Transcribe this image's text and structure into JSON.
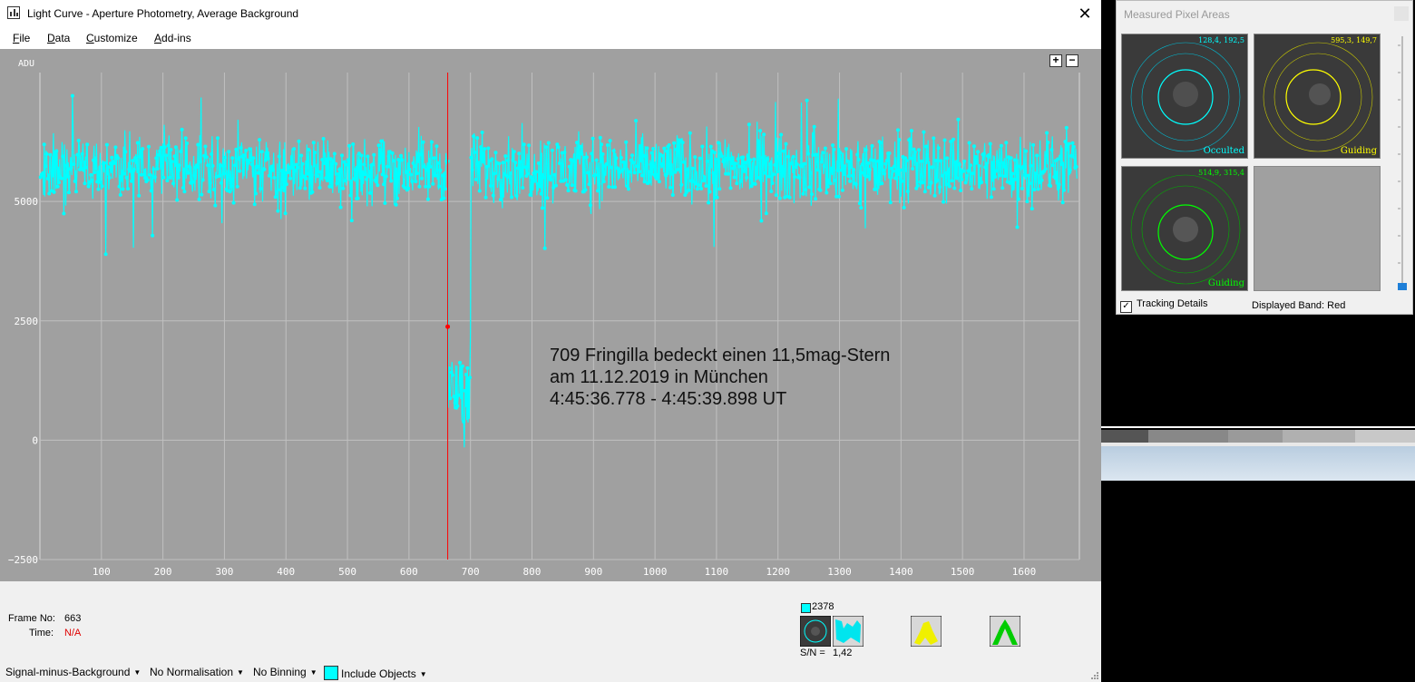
{
  "window": {
    "title": "Light Curve - Aperture Photometry, Average Background",
    "close_glyph": "✕"
  },
  "menu": [
    {
      "label": "File",
      "accel": "F",
      "rest": "ile"
    },
    {
      "label": "Data",
      "accel": "D",
      "rest": "ata"
    },
    {
      "label": "Customize",
      "accel": "C",
      "rest": "ustomize"
    },
    {
      "label": "Add-ins",
      "accel": "A",
      "rest": "dd-ins"
    }
  ],
  "plot": {
    "zoom_in": "+",
    "zoom_out": "−",
    "annotation": [
      "709 Fringilla bedeckt einen 11,5mag-Stern",
      "am 11.12.2019 in München",
      "4:45:36.778 - 4:45:39.898 UT"
    ]
  },
  "chart_data": {
    "type": "line",
    "title": "",
    "ylabel": "ADU",
    "xlabel": "",
    "xlim": [
      0,
      1690
    ],
    "ylim": [
      -2500,
      7700
    ],
    "x_ticks": [
      100,
      200,
      300,
      400,
      500,
      600,
      700,
      800,
      900,
      1000,
      1100,
      1200,
      1300,
      1400,
      1500,
      1600
    ],
    "y_ticks": [
      -2500,
      0,
      2500,
      5000
    ],
    "y_tick_labels": [
      "−2500",
      "0",
      "2500",
      "5000"
    ],
    "grid": true,
    "series": [
      {
        "color": "#00ffff",
        "baseline": 5700,
        "noise_amplitude": 500,
        "frames": 1686,
        "occultation": {
          "start_frame": 664,
          "end_frame": 699,
          "level": 1000,
          "min": -150
        }
      }
    ],
    "cursor": {
      "frame": 663,
      "value": 2378,
      "color": "#ff0000"
    }
  },
  "info": {
    "frame_label": "Frame No:",
    "frame_value": "663",
    "time_label": "Time:",
    "time_value": "N/A",
    "measurement_value": "2378",
    "snr_label": "S/N =",
    "snr_value": "1,42",
    "cyan": "#00ffff",
    "yellow": "#ffff00",
    "green": "#00ff00"
  },
  "bottom_bar": {
    "signal": "Signal-minus-Background",
    "normalisation": "No Normalisation",
    "binning": "No Binning",
    "include": "Include Objects"
  },
  "pixel_areas": {
    "title": "Measured Pixel Areas",
    "panels": [
      {
        "coords": "128,4, 192,5",
        "label": "Occulted",
        "color": "#00ffff"
      },
      {
        "coords": "595,3, 149,7",
        "label": "Guiding",
        "color": "#ffff00"
      },
      {
        "coords": "514,9, 315,4",
        "label": "Guiding",
        "color": "#00ff00"
      }
    ],
    "tracking_label": "Tracking Details",
    "tracking_checked": "✓",
    "band": "Displayed Band: Red"
  }
}
